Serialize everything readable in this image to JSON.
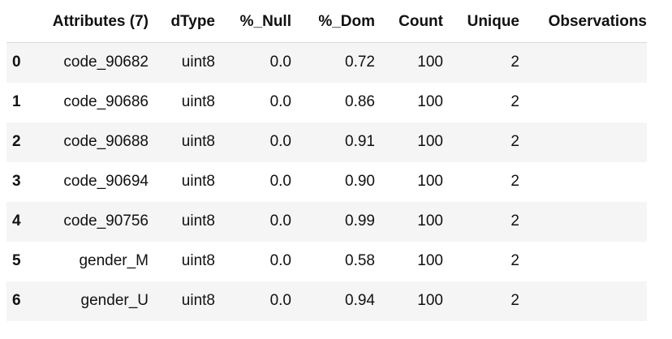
{
  "table": {
    "columns": [
      "Attributes (7)",
      "dType",
      "%_Null",
      "%_Dom",
      "Count",
      "Unique",
      "Observations"
    ],
    "rows": [
      {
        "index": "0",
        "attribute": "code_90682",
        "dtype": "uint8",
        "null": "0.0",
        "dom": "0.72",
        "count": "100",
        "unique": "2",
        "observations": ""
      },
      {
        "index": "1",
        "attribute": "code_90686",
        "dtype": "uint8",
        "null": "0.0",
        "dom": "0.86",
        "count": "100",
        "unique": "2",
        "observations": ""
      },
      {
        "index": "2",
        "attribute": "code_90688",
        "dtype": "uint8",
        "null": "0.0",
        "dom": "0.91",
        "count": "100",
        "unique": "2",
        "observations": ""
      },
      {
        "index": "3",
        "attribute": "code_90694",
        "dtype": "uint8",
        "null": "0.0",
        "dom": "0.90",
        "count": "100",
        "unique": "2",
        "observations": ""
      },
      {
        "index": "4",
        "attribute": "code_90756",
        "dtype": "uint8",
        "null": "0.0",
        "dom": "0.99",
        "count": "100",
        "unique": "2",
        "observations": ""
      },
      {
        "index": "5",
        "attribute": "gender_M",
        "dtype": "uint8",
        "null": "0.0",
        "dom": "0.58",
        "count": "100",
        "unique": "2",
        "observations": ""
      },
      {
        "index": "6",
        "attribute": "gender_U",
        "dtype": "uint8",
        "null": "0.0",
        "dom": "0.94",
        "count": "100",
        "unique": "2",
        "observations": ""
      }
    ]
  },
  "colors": {
    "stripe": "#f5f5f5",
    "header_rule": "#d9d9d9",
    "text": "#111111"
  }
}
